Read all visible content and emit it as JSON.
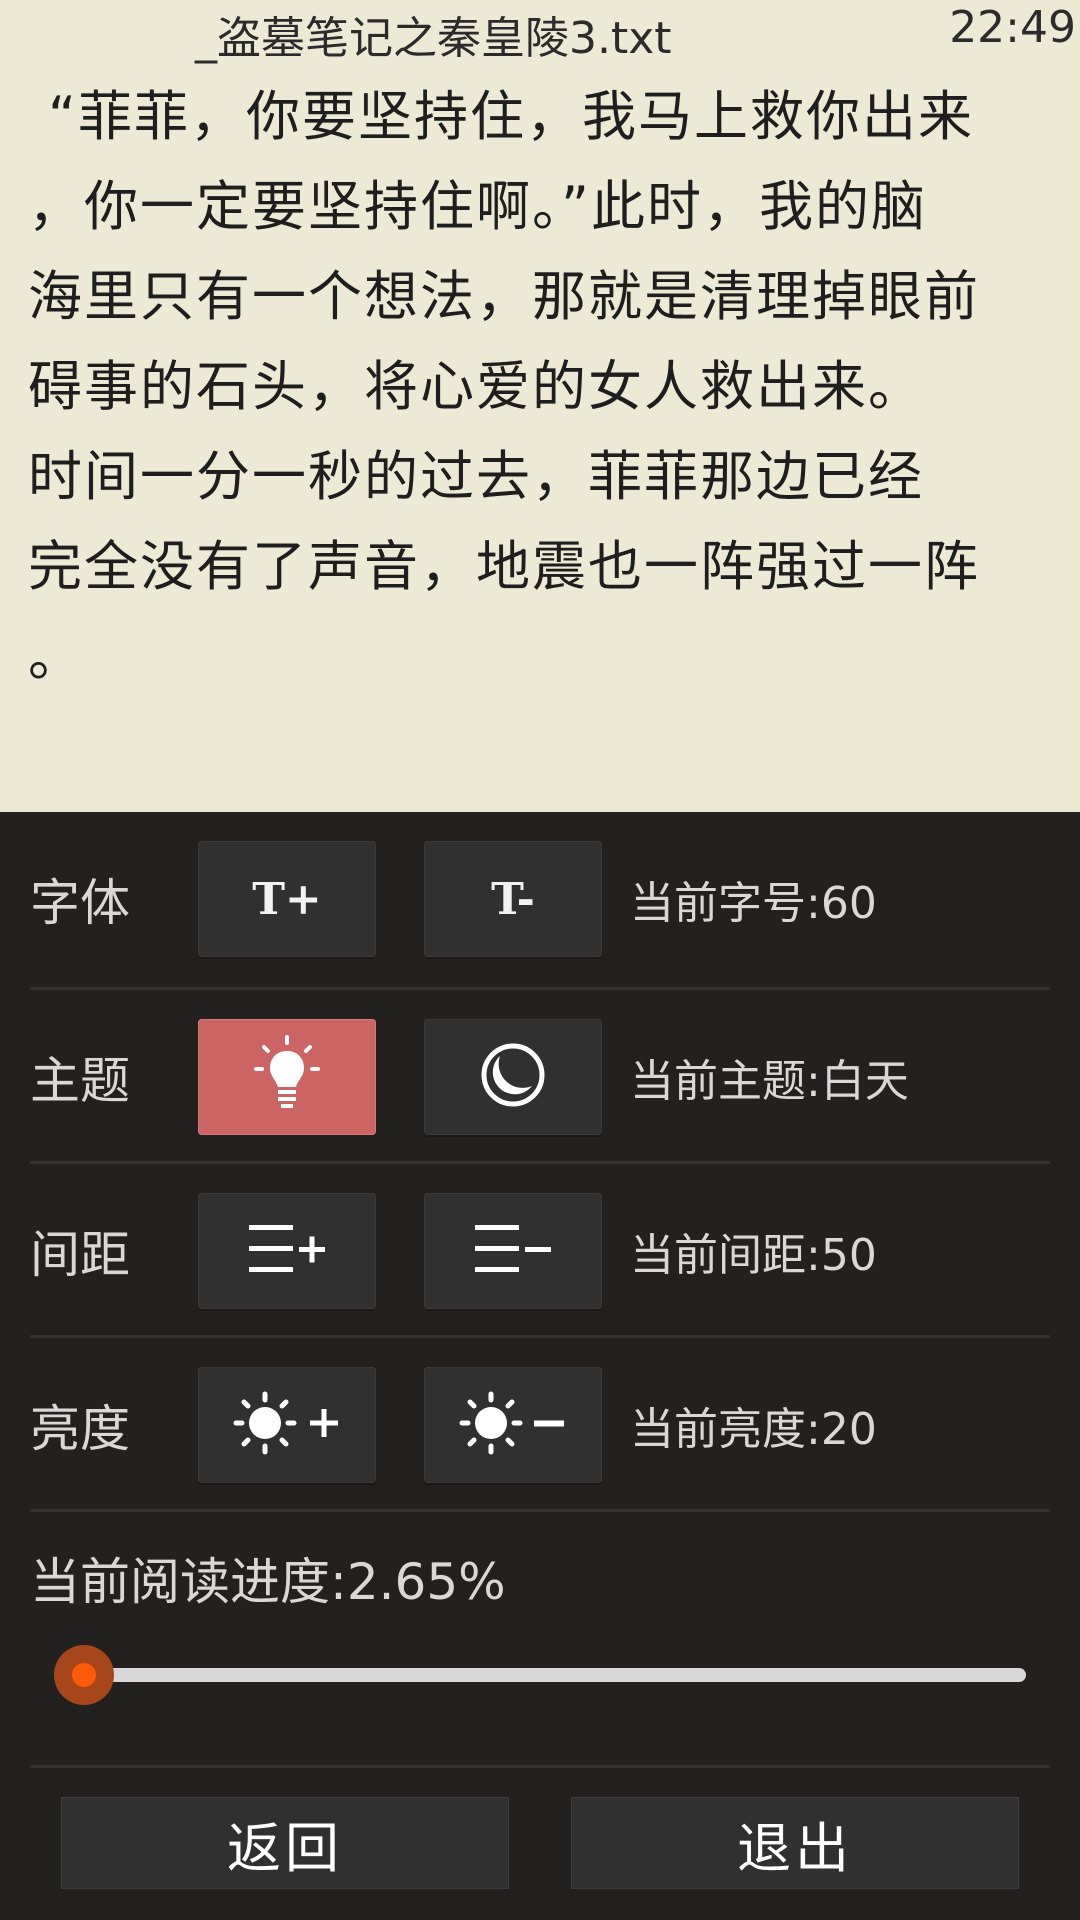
{
  "status": {
    "title": "_盗墓笔记之秦皇陵3.txt",
    "time": "22:49"
  },
  "reader": {
    "lines": [
      "“菲菲，你要坚持住，我马上救你出来",
      "，你一定要坚持住啊。”此时，我的脑",
      "海里只有一个想法，那就是清理掉眼前",
      "碍事的石头，将心爱的女人救出来。",
      " 时间一分一秒的过去，菲菲那边已经",
      "完全没有了声音，地震也一阵强过一阵",
      "。"
    ]
  },
  "settings": {
    "font": {
      "label": "字体",
      "increase": "T+",
      "decrease": "T-",
      "value": "当前字号:60"
    },
    "theme": {
      "label": "主题",
      "day_icon": "lightbulb-icon",
      "night_icon": "moon-icon",
      "value": "当前主题:白天",
      "active_color": "#cd6464"
    },
    "spacing": {
      "label": "间距",
      "increase_icon": "line-spacing-increase-icon",
      "decrease_icon": "line-spacing-decrease-icon",
      "value": "当前间距:50"
    },
    "brightness": {
      "label": "亮度",
      "increase_icon": "brightness-increase-icon",
      "decrease_icon": "brightness-decrease-icon",
      "value": "当前亮度:20"
    },
    "progress": {
      "label": "当前阅读进度:2.65%",
      "percent": 2.65,
      "accent": "#f05a10"
    }
  },
  "actions": {
    "back": "返回",
    "exit": "退出"
  },
  "colors": {
    "reader_bg": "#ecead4",
    "panel_bg": "#23211f",
    "button_bg": "#303030"
  }
}
